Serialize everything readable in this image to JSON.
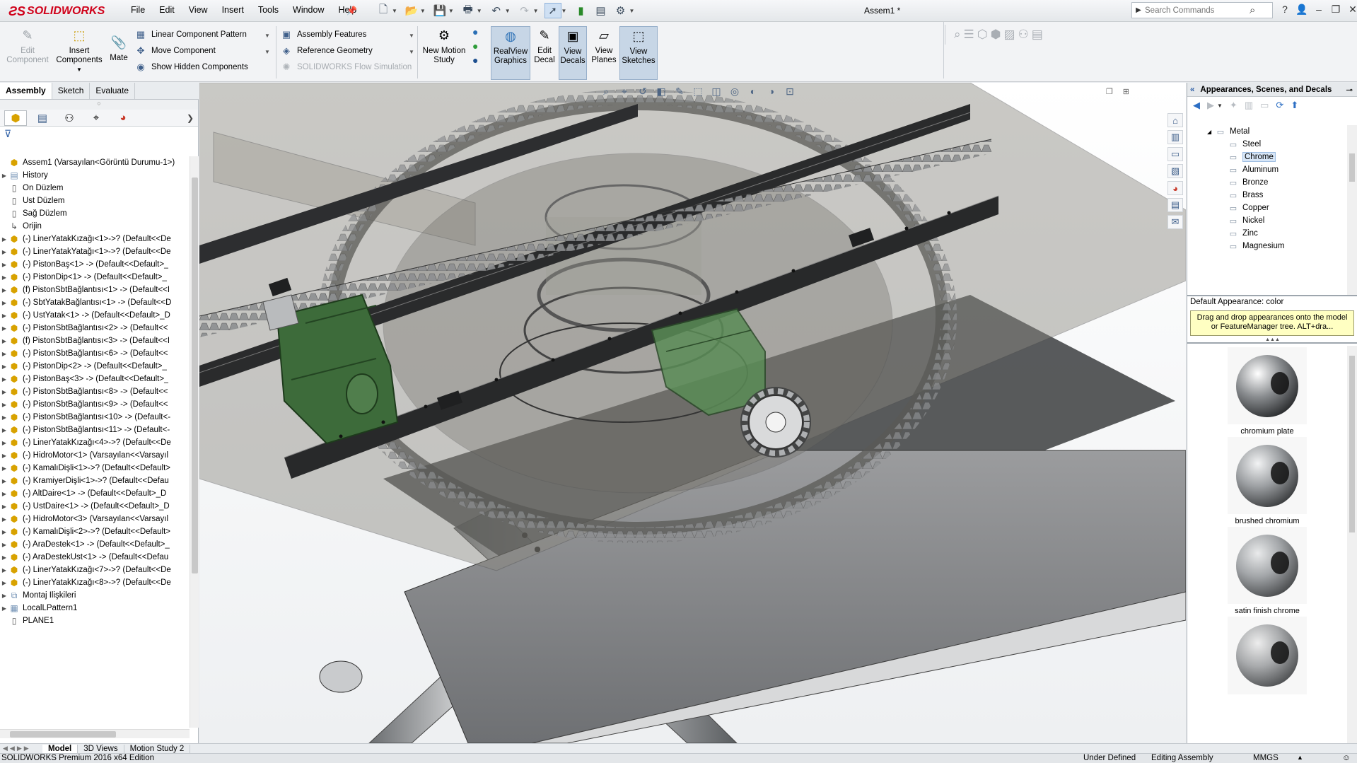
{
  "app": {
    "brand": "SOLIDWORKS",
    "doc_title": "Assem1 *"
  },
  "menu": [
    "File",
    "Edit",
    "View",
    "Insert",
    "Tools",
    "Window",
    "Help"
  ],
  "search": {
    "placeholder": "Search Commands"
  },
  "ribbon": {
    "edit_component": "Edit Component",
    "insert_components": "Insert Components",
    "mate": "Mate",
    "linear_component_pattern": "Linear Component Pattern",
    "move_component": "Move Component",
    "show_hidden_components": "Show Hidden Components",
    "assembly_features": "Assembly Features",
    "reference_geometry": "Reference Geometry",
    "flow_simulation": "SOLIDWORKS Flow Simulation",
    "new_motion_study": "New Motion Study",
    "realview_graphics": "RealView Graphics",
    "edit_decal": "Edit Decal",
    "view_decals": "View Decals",
    "view_planes": "View Planes",
    "view_sketches": "View Sketches"
  },
  "cm_tabs": [
    "Assembly",
    "Sketch",
    "Evaluate"
  ],
  "feature_tree": {
    "root": "Assem1  (Varsayılan<Görüntü Durumu-1>)",
    "items": [
      {
        "type": "folder",
        "label": "History"
      },
      {
        "type": "plane",
        "label": "Ön Düzlem"
      },
      {
        "type": "plane",
        "label": "Üst Düzlem"
      },
      {
        "type": "plane",
        "label": "Sağ Düzlem"
      },
      {
        "type": "origin",
        "label": "Orijin"
      },
      {
        "type": "part",
        "label": "(-) LinerYatakKızağı<1>->? (Default<<De"
      },
      {
        "type": "part",
        "label": "(-) LinerYatakYatağı<1>->? (Default<<De"
      },
      {
        "type": "part",
        "label": "(-) PistonBaş<1> -> (Default<<Default>_"
      },
      {
        "type": "part",
        "label": "(-) PistonDip<1> -> (Default<<Default>_"
      },
      {
        "type": "part",
        "label": "(f) PistonSbtBağlantısı<1> -> (Default<<I"
      },
      {
        "type": "part",
        "label": "(-) SbtYatakBağlantısı<1> -> (Default<<D"
      },
      {
        "type": "part",
        "label": "(-) ÜstYatak<1> -> (Default<<Default>_D"
      },
      {
        "type": "part",
        "label": "(-) PistonSbtBağlantısı<2> -> (Default<<"
      },
      {
        "type": "part",
        "label": "(f) PistonSbtBağlantısı<3> -> (Default<<I"
      },
      {
        "type": "part",
        "label": "(-) PistonSbtBağlantısı<6> -> (Default<<"
      },
      {
        "type": "part",
        "label": "(-) PistonDip<2> -> (Default<<Default>_"
      },
      {
        "type": "part",
        "label": "(-) PistonBaş<3> -> (Default<<Default>_"
      },
      {
        "type": "part",
        "label": "(-) PistonSbtBağlantısı<8> -> (Default<<"
      },
      {
        "type": "part",
        "label": "(-) PistonSbtBağlantısı<9> -> (Default<<"
      },
      {
        "type": "part",
        "label": "(-) PistonSbtBağlantısı<10> -> (Default<-"
      },
      {
        "type": "part",
        "label": "(-) PistonSbtBağlantısı<11> -> (Default<-"
      },
      {
        "type": "part",
        "label": "(-) LinerYatakKızağı<4>->? (Default<<De"
      },
      {
        "type": "part",
        "label": "(-) HidroMotor<1> (Varsayılan<<Varsayıl"
      },
      {
        "type": "part",
        "label": "(-) KamalıDişli<1>->? (Default<<Default>"
      },
      {
        "type": "part",
        "label": "(-) KramiyerDişli<1>->? (Default<<Defau"
      },
      {
        "type": "part",
        "label": "(-) AltDaire<1> -> (Default<<Default>_D"
      },
      {
        "type": "part",
        "label": "(-) ÜstDaire<1> -> (Default<<Default>_D"
      },
      {
        "type": "part",
        "label": "(-) HidroMotor<3> (Varsayılan<<Varsayıl"
      },
      {
        "type": "part",
        "label": "(-) KamalıDişli<2>->? (Default<<Default>"
      },
      {
        "type": "part",
        "label": "(-) AraDestek<1> -> (Default<<Default>_"
      },
      {
        "type": "part",
        "label": "(-) AraDestekÜst<1> -> (Default<<Defau"
      },
      {
        "type": "part",
        "label": "(-) LinerYatakKızağı<7>->? (Default<<De"
      },
      {
        "type": "part",
        "label": "(-) LinerYatakKızağı<8>->? (Default<<De"
      },
      {
        "type": "mates",
        "label": "Montaj İlişkileri"
      },
      {
        "type": "pattern",
        "label": "LocalLPattern1"
      },
      {
        "type": "plane",
        "label": "PLANE1"
      }
    ]
  },
  "bottom_tabs": [
    "Model",
    "3D Views",
    "Motion Study 2"
  ],
  "status": {
    "edition": "SOLIDWORKS Premium 2016 x64 Edition",
    "state": "Under Defined",
    "mode": "Editing Assembly",
    "units": "MMGS"
  },
  "task_pane": {
    "title": "Appearances, Scenes, and Decals",
    "tree_root": "Metal",
    "tree_items": [
      "Steel",
      "Chrome",
      "Aluminum",
      "Bronze",
      "Brass",
      "Copper",
      "Nickel",
      "Zinc",
      "Magnesium"
    ],
    "selected": "Chrome",
    "default_appearance": "Default Appearance: color",
    "tip": "Drag and drop appearances onto the model or FeatureManager tree.  ALT+dra...",
    "swatches": [
      "chromium plate",
      "brushed chromium",
      "satin finish chrome",
      ""
    ]
  }
}
